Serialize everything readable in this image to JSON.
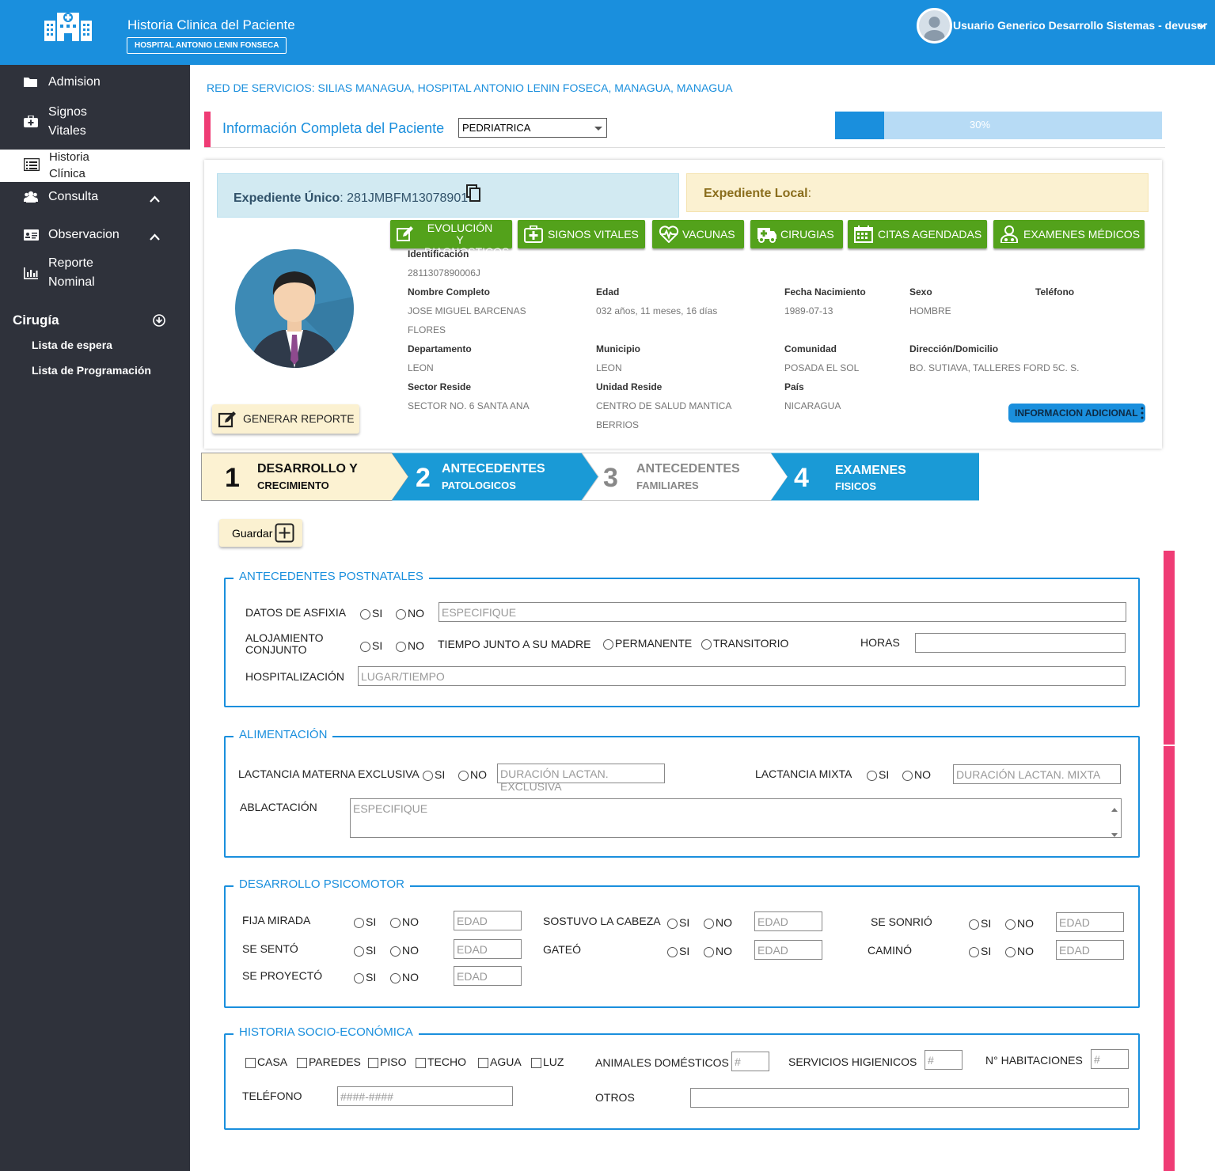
{
  "header": {
    "title": "Historia Clinica del Paciente",
    "hospital": "HOSPITAL ANTONIO LENIN FONSECA",
    "user": "Usuario Generico Desarrollo Sistemas - devuser"
  },
  "sidebar": {
    "admision": "Admision",
    "signos1": "Signos",
    "signos2": "Vitales",
    "historia1": "Historia",
    "historia2": "Clínica",
    "consulta": "Consulta",
    "observacion": "Observacion",
    "reporte1": "Reporte",
    "reporte2": "Nominal",
    "cirugia": "Cirugía",
    "lista_espera": "Lista de espera",
    "lista_programacion": "Lista de Programación"
  },
  "main": {
    "red_servicios": "RED DE SERVICIOS: SILIAS MANAGUA, HOSPITAL ANTONIO LENIN FOSECA, MANAGUA, MANAGUA",
    "info_title": "Información Completa del Paciente",
    "select_value": "PEDRIATRICA",
    "progress_percent": 30,
    "progress_label": "30%"
  },
  "expediente": {
    "unico_label": "Expediente Único",
    "unico_value": ": 281JMBFM13078901",
    "local_label": "Expediente Local",
    "local_value": ":"
  },
  "actions": {
    "evol1": "EVOLUCIÓN Y",
    "evol2": "DIAGNOSTICOS",
    "signos": "SIGNOS VITALES",
    "vacunas": "VACUNAS",
    "cirugias": "CIRUGIAS",
    "citas": "CITAS AGENDADAS",
    "examenes": "EXAMENES MÉDICOS"
  },
  "patient": {
    "identificacion_label": "Identificación",
    "identificacion": "2811307890006J",
    "nombre_label": "Nombre Completo",
    "nombre1": "JOSE MIGUEL BARCENAS",
    "nombre2": "FLORES",
    "edad_label": "Edad",
    "edad": "032 años, 11 meses, 16 días",
    "fecha_label": "Fecha Nacimiento",
    "fecha": "1989-07-13",
    "sexo_label": "Sexo",
    "sexo": "HOMBRE",
    "telefono_label": "Teléfono",
    "departamento_label": "Departamento",
    "departamento": "LEON",
    "municipio_label": "Municipio",
    "municipio": "LEON",
    "comunidad_label": "Comunidad",
    "comunidad": "POSADA EL SOL",
    "direccion_label": "Dirección/Domicilio",
    "direccion": "BO. SUTIAVA, TALLERES FORD 5C. S.",
    "sector_label": "Sector Reside",
    "sector": "SECTOR NO. 6 SANTA ANA",
    "unidad_label": "Unidad Reside",
    "unidad1": "CENTRO DE SALUD MANTICA",
    "unidad2": "BERRIOS",
    "pais_label": "País",
    "pais": "NICARAGUA",
    "generar_reporte": "GENERAR REPORTE",
    "info_adicional": "INFORMACION ADICIONAL"
  },
  "steps": [
    {
      "num": "1",
      "title": "DESARROLLO Y",
      "sub": "CRECIMIENTO"
    },
    {
      "num": "2",
      "title": "ANTECEDENTES",
      "sub": "PATOLOGICOS"
    },
    {
      "num": "3",
      "title": "ANTECEDENTES",
      "sub": "FAMILIARES"
    },
    {
      "num": "4",
      "title": "EXAMENES",
      "sub": "FISICOS"
    }
  ],
  "form": {
    "guardar": "Guardar",
    "si": "SI",
    "no": "NO",
    "postnatales": {
      "legend": "ANTECEDENTES POSTNATALES",
      "asfixia": "DATOS DE ASFIXIA",
      "especifique": "ESPECIFIQUE",
      "aloj1": "ALOJAMIENTO",
      "aloj2": "CONJUNTO",
      "tiempo": "TIEMPO JUNTO A SU MADRE",
      "permanente": "PERMANENTE",
      "transitorio": "TRANSITORIO",
      "horas": "HORAS",
      "hospitalizacion": "HOSPITALIZACIÓN",
      "lugar": "LUGAR/TIEMPO"
    },
    "alimentacion": {
      "legend": "ALIMENTACIÓN",
      "lactancia_exclusiva": "LACTANCIA MATERNA EXCLUSIVA",
      "duracion_exclusiva": "DURACIÓN LACTAN. EXCLUSIVA",
      "lactancia_mixta": "LACTANCIA MIXTA",
      "duracion_mixta": "DURACIÓN LACTAN. MIXTA",
      "ablactacion": "ABLACTACIÓN",
      "especifique": "ESPECIFIQUE"
    },
    "psicomotor": {
      "legend": "DESARROLLO PSICOMOTOR",
      "fija": "FIJA MIRADA",
      "sostuvo": "SOSTUVO LA CABEZA",
      "sonrio": "SE SONRIÓ",
      "sento": "SE SENTÓ",
      "gateo": "GATEÓ",
      "camino": "CAMINÓ",
      "proyecto": "SE PROYECTÓ",
      "edad": "EDAD"
    },
    "socio": {
      "legend": "HISTORIA SOCIO-ECONÓMICA",
      "casa": "CASA",
      "paredes": "PAREDES",
      "piso": "PISO",
      "techo": "TECHO",
      "agua": "AGUA",
      "luz": "LUZ",
      "animales": "ANIMALES DOMÉSTICOS",
      "servicios": "SERVICIOS HIGIENICOS",
      "habitaciones": "N° HABITACIONES",
      "hash": "#",
      "telefono": "TELÉFONO",
      "telefono_ph": "####-####",
      "otros": "OTROS"
    }
  }
}
